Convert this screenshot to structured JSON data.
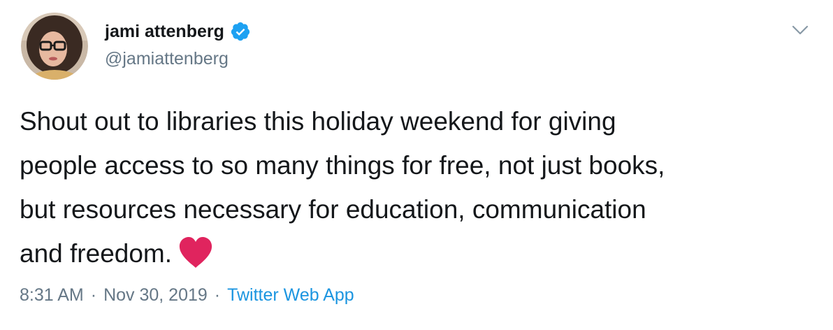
{
  "author": {
    "display_name": "jami attenberg",
    "handle": "@jamiattenberg",
    "verified": true,
    "avatar_icon": "user-avatar-photo",
    "verified_icon": "verified-badge-icon"
  },
  "tweet": {
    "text": "Shout out to libraries this holiday weekend for giving\npeople access to so many things for free, not just books,\nbut resources necessary for education, communication\nand freedom.",
    "emoji_icon": "red-heart-emoji",
    "time": "8:31 AM",
    "date": "Nov 30, 2019",
    "separator": "·",
    "source": "Twitter Web App"
  },
  "menu": {
    "icon": "chevron-down-icon"
  },
  "colors": {
    "text": "#14171a",
    "muted": "#657786",
    "link": "#1b95e0",
    "verified": "#1da1f2",
    "heart": "#e0245e"
  }
}
